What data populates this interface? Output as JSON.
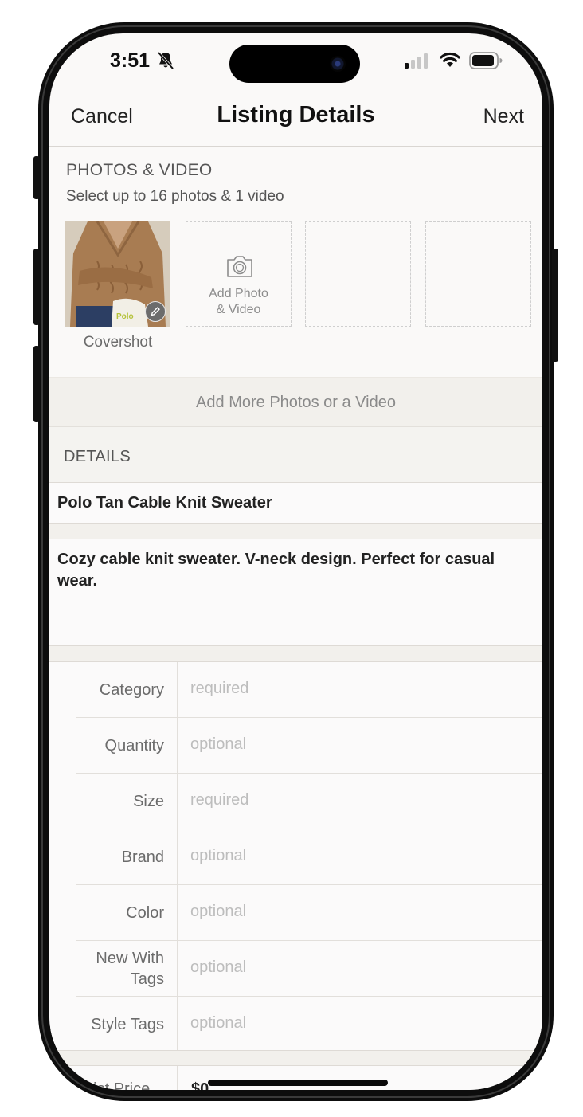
{
  "status_bar": {
    "time": "3:51"
  },
  "nav": {
    "cancel": "Cancel",
    "title": "Listing Details",
    "next": "Next"
  },
  "photos": {
    "header": "PHOTOS & VIDEO",
    "subtitle": "Select up to 16 photos & 1 video",
    "cover_label": "Covershot",
    "add_label": "Add Photo\n& Video",
    "add_more": "Add More Photos or a Video"
  },
  "details": {
    "header": "DETAILS",
    "title": "Polo Tan Cable Knit Sweater",
    "description": "Cozy cable knit sweater. V-neck design. Perfect for casual wear."
  },
  "attributes": [
    {
      "label": "Category",
      "value": "required"
    },
    {
      "label": "Quantity",
      "value": "optional"
    },
    {
      "label": "Size",
      "value": "required"
    },
    {
      "label": "Brand",
      "value": "optional"
    },
    {
      "label": "Color",
      "value": "optional"
    },
    {
      "label": "New With Tags",
      "value": "optional"
    },
    {
      "label": "Style Tags",
      "value": "optional"
    }
  ],
  "price": {
    "label": "List Price",
    "value": "$0"
  },
  "colors": {
    "text": "#222222",
    "muted": "#6b6b6b",
    "placeholder": "#bdbdbd",
    "section_bg": "#f2f0ec"
  }
}
